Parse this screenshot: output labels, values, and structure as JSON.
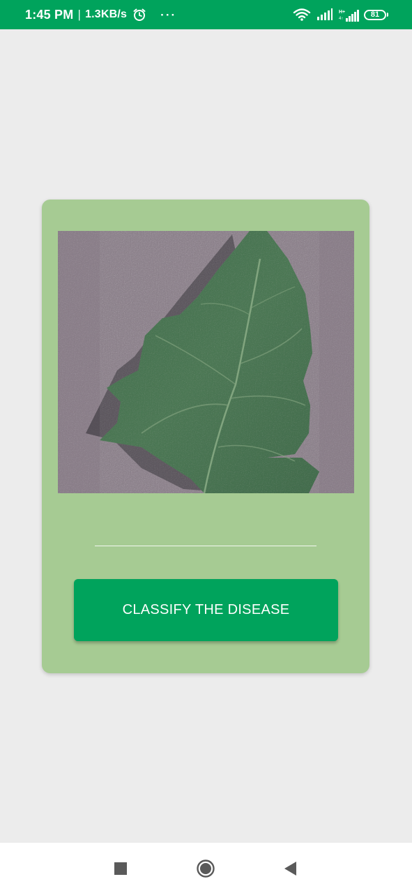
{
  "status_bar": {
    "time": "1:45 PM",
    "separator": "|",
    "network_speed": "1.3KB/s",
    "more_indicator": "···",
    "battery_level": "81",
    "icons": [
      "alarm-icon",
      "wifi-icon",
      "signal-icon",
      "signal-hplus-icon",
      "battery-icon"
    ]
  },
  "card": {
    "image_subject": "leaf-photo",
    "result_text": "",
    "classify_button_label": "CLASSIFY THE DISEASE"
  },
  "nav_bar": {
    "icons": [
      "recent-apps-icon",
      "home-icon",
      "back-icon"
    ]
  },
  "colors": {
    "status_bar": "#00a35c",
    "background": "#ececec",
    "card": "#a6cb93",
    "button": "#00a35c",
    "button_text": "#ffffff"
  }
}
